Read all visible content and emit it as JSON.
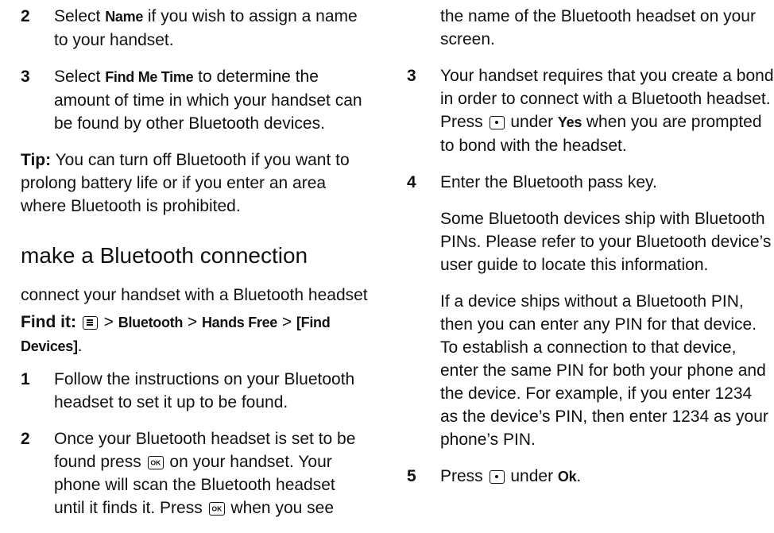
{
  "left": {
    "step2": {
      "num": "2",
      "pre": "Select ",
      "key": "Name",
      "post": " if you wish to assign a name to your handset."
    },
    "step3": {
      "num": "3",
      "pre": "Select ",
      "key": "Find Me Time",
      "post": " to determine the amount of time in which your handset can be found by other Bluetooth devices."
    },
    "tip": {
      "label": "Tip:",
      "text": " You can turn off Bluetooth if you want to prolong battery life or if you enter an area where Bluetooth is prohibited."
    },
    "section_title": "make a Bluetooth connection",
    "subsection_title": "connect your handset with a Bluetooth headset",
    "findit": {
      "label": "Find it:",
      "sep": " > ",
      "path1": "Bluetooth",
      "path2": "Hands Free",
      "path3": "[Find Devices]",
      "end": "."
    },
    "step1": {
      "num": "1",
      "text": "Follow the instructions on your Bluetooth headset to set it up to be found."
    },
    "step2b": {
      "num": "2",
      "part1": "Once your Bluetooth headset is set to be found press ",
      "part2": " on your handset. Your phone will scan the Bluetooth headset until it finds it. Press ",
      "part3": " when you see"
    }
  },
  "right": {
    "continuation": "the name of the Bluetooth headset on your screen.",
    "step3": {
      "num": "3",
      "part1": "Your handset requires that you create a bond in order to connect with a Bluetooth headset. Press ",
      "part2": " under ",
      "key": "Yes",
      "part3": " when you are prompted to bond with the headset."
    },
    "step4": {
      "num": "4",
      "text": "Enter the Bluetooth pass key."
    },
    "para1": "Some Bluetooth devices ship with Bluetooth PINs. Please refer to your Bluetooth device’s user guide to locate this information.",
    "para2": "If a device ships without a Bluetooth PIN, then you can enter any PIN for that device. To establish a connection to that device, enter the same PIN for both your phone and the device. For example, if you enter 1234 as the device’s PIN, then enter 1234 as your phone’s PIN.",
    "step5": {
      "num": "5",
      "part1": "Press ",
      "part2": " under ",
      "key": "Ok",
      "end": "."
    }
  }
}
